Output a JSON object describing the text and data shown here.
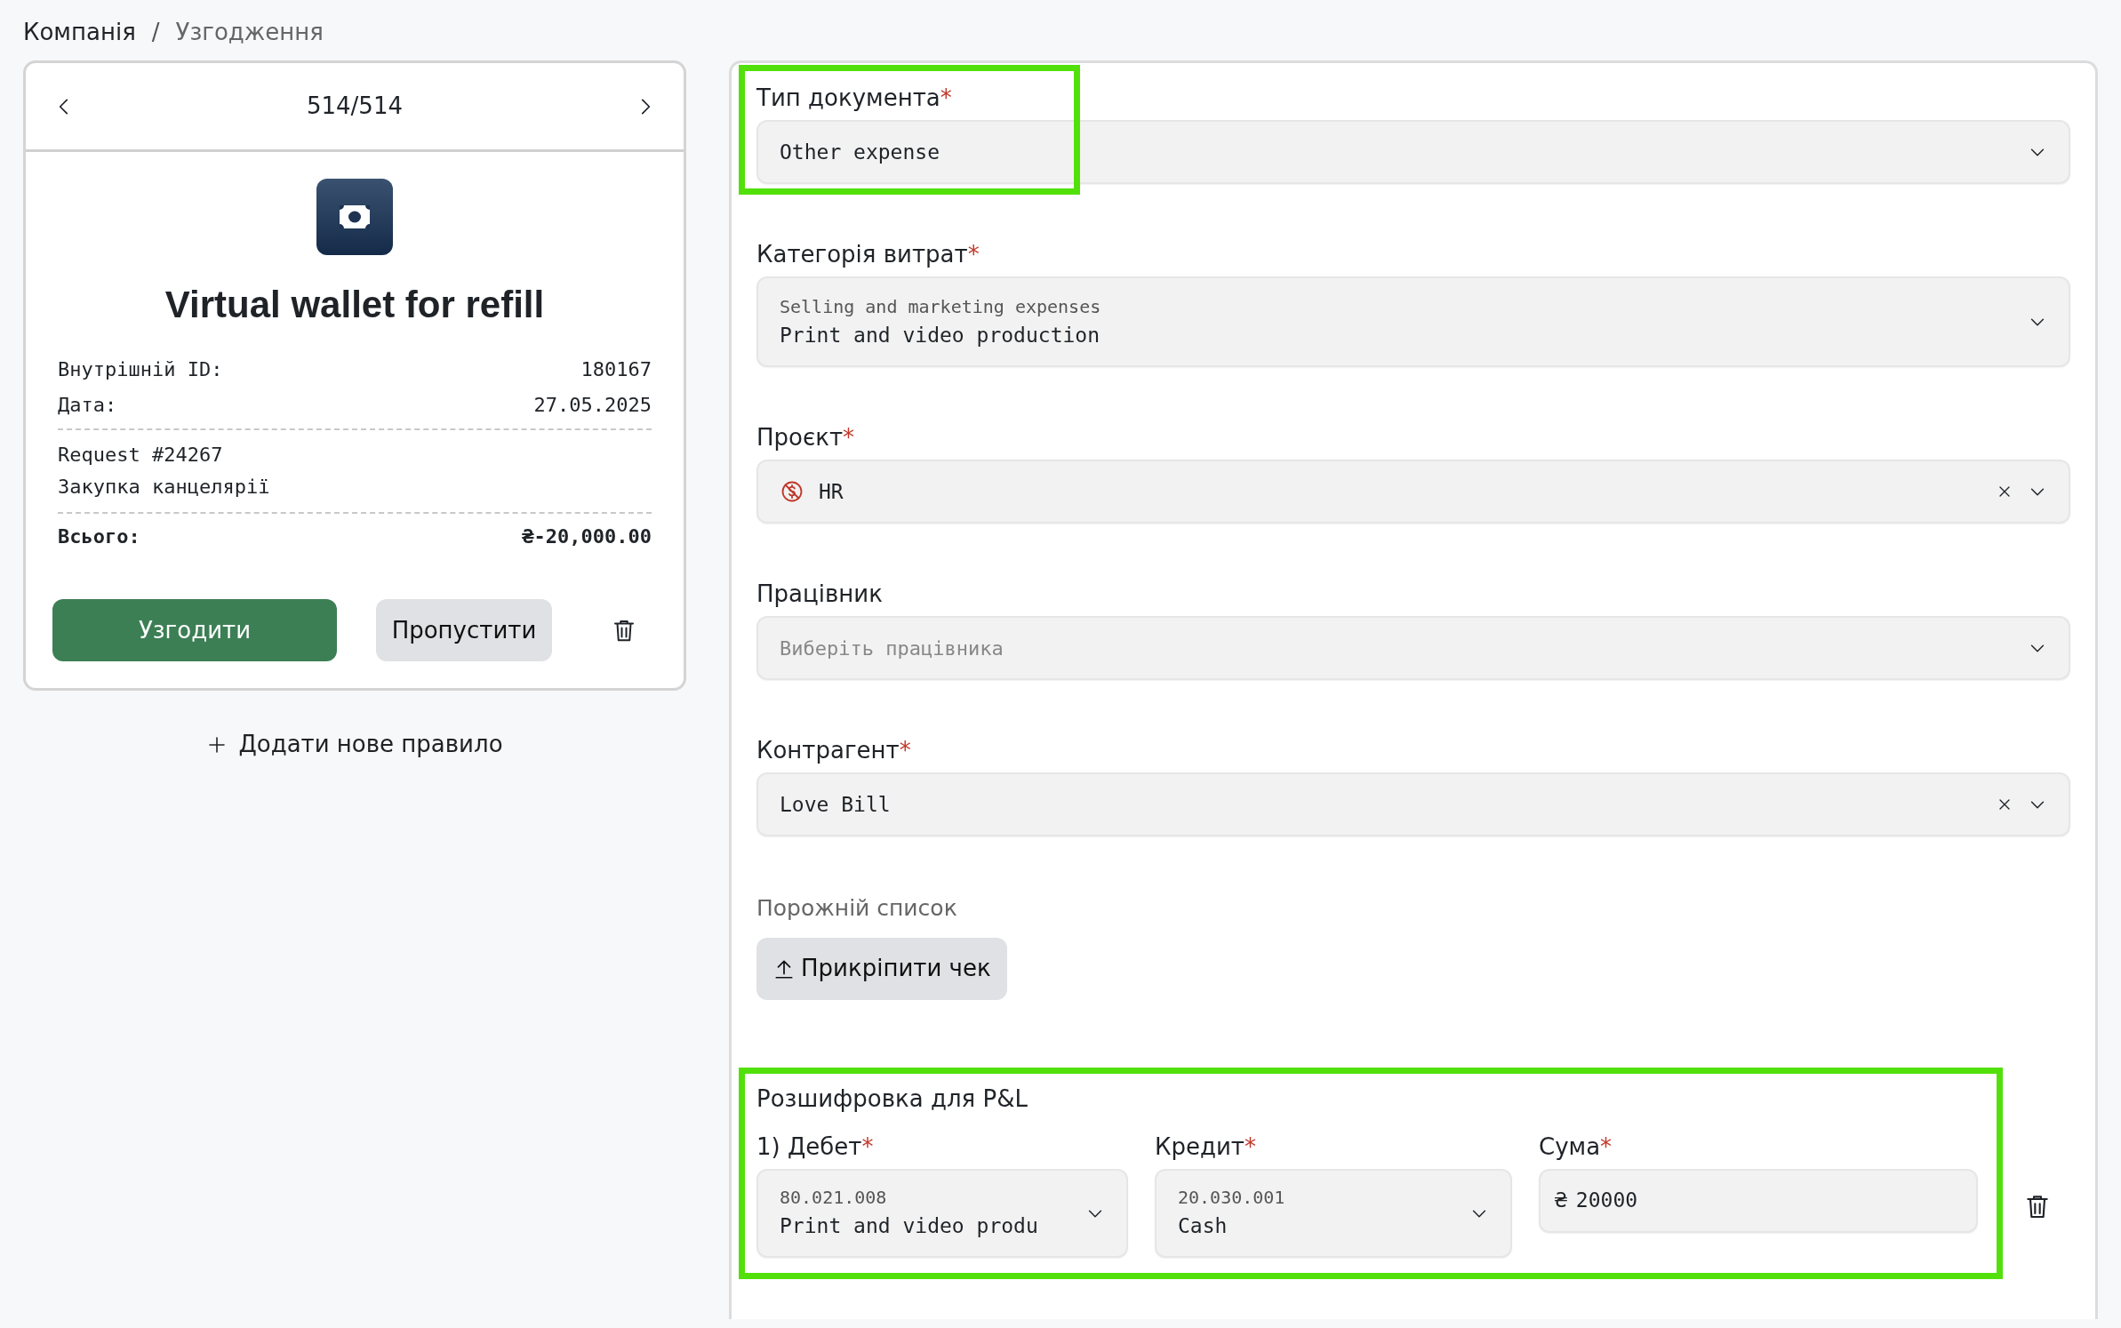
{
  "breadcrumb": [
    {
      "label": "Компанія",
      "current": false
    },
    {
      "label": "Узгодження",
      "current": true
    }
  ],
  "breadcrumb_separator": "/",
  "card": {
    "counter": "514/514",
    "title": "Virtual wallet for refill",
    "details": [
      {
        "label": "Внутрішній ID:",
        "value": "180167"
      },
      {
        "label": "Дата:",
        "value": "27.05.2025"
      }
    ],
    "description": [
      "Request #24267",
      "Закупка канцелярії"
    ],
    "total": {
      "label": "Всього:",
      "value": "₴-20,000.00"
    },
    "buttons": [
      {
        "label": "Узгодити",
        "kind": "primary"
      },
      {
        "label": "Пропустити",
        "kind": "secondary"
      }
    ]
  },
  "add_rule": "Додати нове правило",
  "form": {
    "fields": [
      {
        "label": "Тип документа",
        "required_mark": "*",
        "value": "Other expense",
        "clearable": false,
        "has_icon": false,
        "highlighted": true
      },
      {
        "label": "Категорія витрат",
        "required_mark": "*",
        "group": "Selling and marketing expenses",
        "value": "Print and video production",
        "clearable": false,
        "has_icon": false,
        "highlighted": false
      },
      {
        "label": "Проєкт",
        "required_mark": "*",
        "value": "HR",
        "clearable": true,
        "has_icon": true,
        "highlighted": false
      },
      {
        "label": "Працівник",
        "placeholder": "Виберіть працівника",
        "clearable": false,
        "has_icon": false,
        "highlighted": false
      },
      {
        "label": "Контрагент",
        "required_mark": "*",
        "value": "Love Bill",
        "clearable": true,
        "has_icon": false,
        "highlighted": false
      }
    ],
    "attachments": {
      "empty_text": "Порожній список",
      "button": "Прикріпити чек"
    },
    "pl": {
      "title": "Розшифровка для P&L",
      "highlighted": true,
      "rows": [
        {
          "debit": {
            "label": "1) Дебет",
            "required_mark": "*",
            "code": "80.021.008",
            "value": "Print and video produ"
          },
          "credit": {
            "label": "Кредит",
            "required_mark": "*",
            "code": "20.030.001",
            "value": "Cash"
          },
          "amount": {
            "label": "Сума",
            "required_mark": "*",
            "currency": "₴",
            "value": "20000"
          }
        }
      ]
    }
  }
}
